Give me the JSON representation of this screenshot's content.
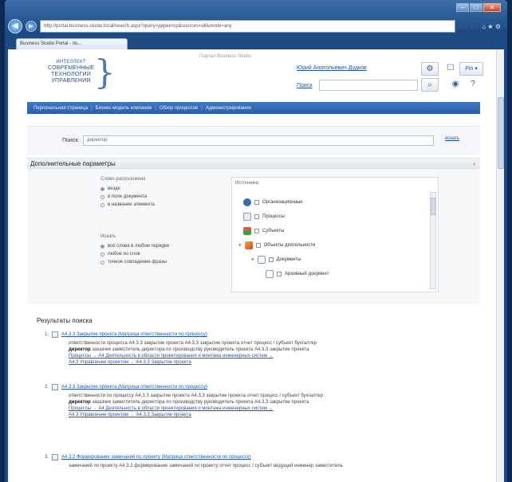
{
  "browser": {
    "address": "http://portal.business-studio.local/search.aspx?query=директор&sources=all&mode=any",
    "tab_title": "Business Studio Portal - по...",
    "min": "–",
    "max": "□",
    "close": "✕",
    "back": "◀",
    "forward": "▶",
    "addr_icons": "⟳ ▾ ✕ ⌕",
    "tools": "⌂ ★ ⚙"
  },
  "header": {
    "logo_line1": "ИНТЕЛЛЕКТ",
    "logo_line2": "СОВРЕМЕННЫЕ",
    "logo_line3": "ТЕХНОЛОГИИ",
    "logo_line4": "УПРАВЛЕНИЯ",
    "site_title": "Портал Business Studio",
    "user_name": "Юрий Анатольевич Дудков",
    "search_link": "Поиск",
    "gear": "⚙",
    "phone": "☐",
    "pin_label": "Pin ▾",
    "search_btn": "⌕",
    "eye": "◉",
    "help": "?"
  },
  "nav": {
    "items": [
      "Персональная страница",
      "Бизнес-модель компании",
      "Обзор процессов",
      "Администрирование"
    ],
    "sep": "|"
  },
  "search": {
    "label": "Поиск:",
    "value": "директор",
    "go": "искать"
  },
  "advanced": {
    "title": "Дополнительные параметры",
    "toggle": "‹",
    "where_title": "Слово расположено",
    "where": [
      "везде",
      "в поле документа",
      "в названии элемента"
    ],
    "match_title": "Искать",
    "match": [
      "все слова в любом порядке",
      "любое из слов",
      "точное совпадение фразы"
    ],
    "sources_title": "Источники",
    "sources": [
      "Организационные",
      "Процессы",
      "Субъекты",
      "Объекты деятельности",
      "Документы",
      "Архивный документ"
    ]
  },
  "results": {
    "title": "Результаты поиска",
    "items": [
      {
        "num": "1.",
        "link": "А4.3.3 Закрытие проекта (Матрица ответственности по процессу)",
        "snippet_pre": "ответственности процесса А4.3.3 закрытие проекта А4.3.3 закрытие проекта отчет процесс / субъект бухгалтер",
        "snippet_bold": "директор",
        "snippet_post": "заказчик заместитель директора по производству руководитель проекта А4.3.3 закрытие проекта",
        "crumbs1": "Процессы → А4 Деятельность в области проектирования и монтажа инженерных систем →",
        "crumbs2": "А4.3 Управление проектом → А4.3.3 Закрытие проекта"
      },
      {
        "num": "2.",
        "link": "А4.3.3 Закрытие проекта (Матрица ответственности по процессу)",
        "snippet_pre": "ответственности по процессу А4.3.3 закрытие проекта А4.3.3 закрытие проекта отчет процесс / субъект бухгалтер",
        "snippet_bold": "директор",
        "snippet_post": "заказчик заместитель директора по производству руководитель проекта А4.3.3 закрытие проекта",
        "crumbs1": "Процессы → А4 Деятельность в области проектирования и монтажа инженерных систем →",
        "crumbs2": "А4.3 Управление проектом → А4.3.3 Закрытие проекта"
      },
      {
        "num": "3.",
        "link": "А4.3.2 Формирование замечаний по проекту (Матрица ответственности по процессу)",
        "snippet_pre": "замечаний по проекту А4.3.2 формирование замечаний по проекту отчет процесс / субъект ведущий инженер заместитель",
        "snippet_bold": "",
        "snippet_post": "",
        "crumbs1": "",
        "crumbs2": ""
      }
    ]
  }
}
